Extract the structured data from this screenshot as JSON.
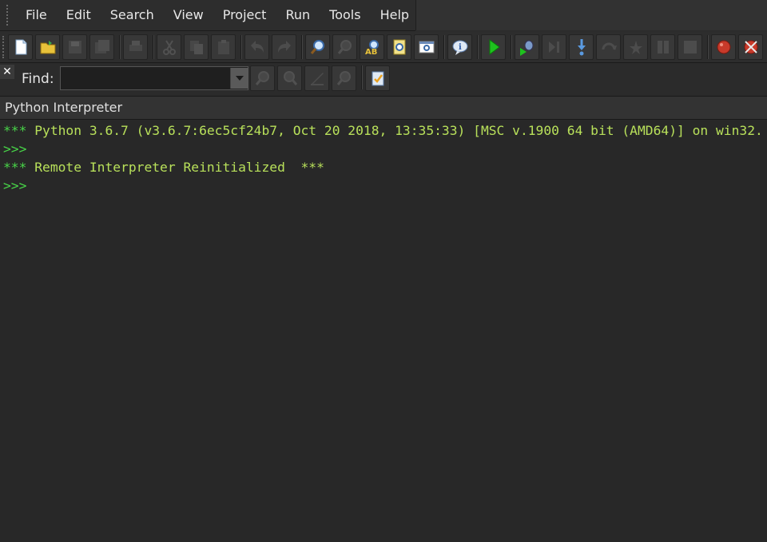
{
  "menu": [
    "File",
    "Edit",
    "Search",
    "View",
    "Project",
    "Run",
    "Tools",
    "Help"
  ],
  "toolbar": {
    "buttons": [
      "new-file-icon",
      "open-folder-icon",
      "save-icon",
      "save-all-icon",
      "print-icon",
      "cut-icon",
      "copy-icon",
      "paste-icon",
      "undo-icon",
      "redo-icon",
      "find-icon",
      "find-next-icon",
      "replace-icon",
      "find-in-files-icon",
      "browser-icon",
      "info-icon",
      "run-icon",
      "debug-icon",
      "step-over-icon",
      "step-into-icon",
      "step-out-icon",
      "run-to-cursor-icon",
      "pause-icon",
      "stop-icon",
      "breakpoint-icon",
      "clear-breakpoints-icon"
    ]
  },
  "find": {
    "close": "✕",
    "label": "Find:",
    "value": ""
  },
  "panel": {
    "title": "Python Interpreter"
  },
  "console": {
    "lines": [
      {
        "prompt": "***",
        "text": " Python 3.6.7 (v3.6.7:6ec5cf24b7, Oct 20 2018, 13:35:33) [MSC v.1900 64 bit (AMD64)] on win32."
      },
      {
        "prompt": ">>>",
        "text": ""
      },
      {
        "prompt": "***",
        "text": " Remote Interpreter Reinitialized  ***"
      },
      {
        "prompt": ">>>",
        "text": ""
      }
    ]
  },
  "colors": {
    "prompt": "#48d648",
    "output": "#b8e05a",
    "background": "#282828"
  }
}
